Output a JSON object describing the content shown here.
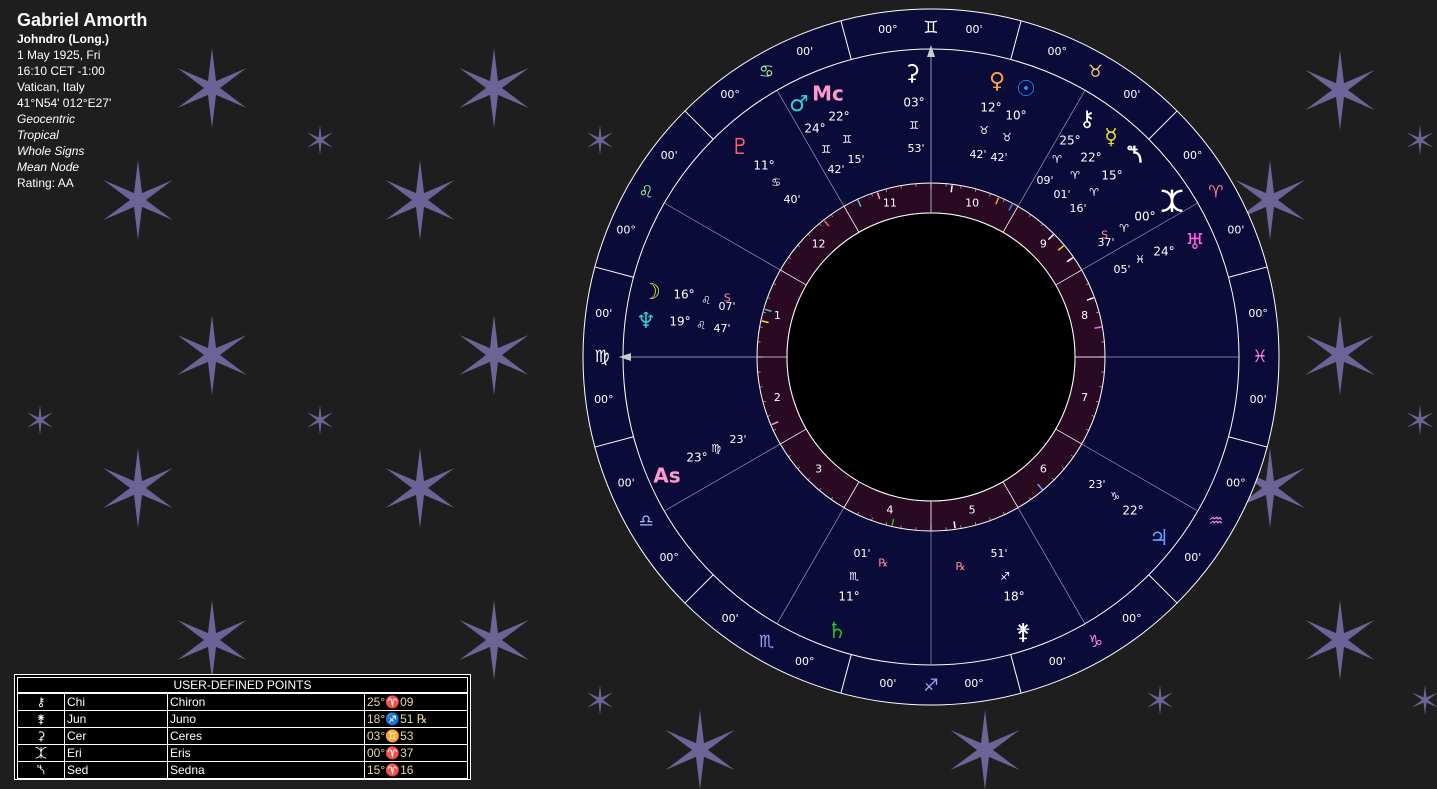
{
  "info": {
    "name": "Gabriel Amorth",
    "house_system": "Johndro (Long.)",
    "date": "1 May 1925, Fri",
    "time": "16:10  CET -1:00",
    "place": "Vatican, Italy",
    "coords": "41°N54' 012°E27'",
    "options": [
      "Geocentric",
      "Tropical",
      "Whole Signs",
      "Mean Node"
    ],
    "rating": "Rating: AA"
  },
  "colors": {
    "background": "#1e1e1e",
    "wheel": "#0b0b3a",
    "house_ring": "#2a0a22",
    "star": "#6c6496"
  },
  "wheel": {
    "zodiac": [
      {
        "glyph": "♊",
        "a": "00°",
        "b": "00'",
        "color": "#ffffff"
      },
      {
        "glyph": "♉",
        "a": "00°",
        "b": "00'",
        "color": "#ffd070"
      },
      {
        "glyph": "♈",
        "a": "00°",
        "b": "00'",
        "color": "#ff8080"
      },
      {
        "glyph": "♓",
        "a": "00°",
        "b": "00'",
        "color": "#ff88dd"
      },
      {
        "glyph": "♒",
        "a": "00°",
        "b": "00'",
        "color": "#ff88dd"
      },
      {
        "glyph": "♑",
        "a": "00°",
        "b": "00'",
        "color": "#ff88dd"
      },
      {
        "glyph": "♐",
        "a": "00°",
        "b": "00'",
        "color": "#a0a0ff"
      },
      {
        "glyph": "♏",
        "a": "00°",
        "b": "00'",
        "color": "#a0a0ff"
      },
      {
        "glyph": "♎",
        "a": "00°",
        "b": "00'",
        "color": "#a0c0ff"
      },
      {
        "glyph": "♍",
        "a": "00°",
        "b": "00'",
        "color": "#ffffff"
      },
      {
        "glyph": "♌",
        "a": "00°",
        "b": "00'",
        "color": "#a0ffa0"
      },
      {
        "glyph": "♋",
        "a": "00°",
        "b": "00'",
        "color": "#a0ffa0"
      }
    ],
    "houses": [
      "10",
      "9",
      "8",
      "7",
      "6",
      "5",
      "4",
      "3",
      "2",
      "1",
      "12",
      "11"
    ],
    "planets": [
      {
        "glyph": "⚳",
        "color": "#ffffff",
        "deg": "03°",
        "sign": "♊",
        "min": "53'",
        "retro": ""
      },
      {
        "glyph": "♀",
        "color": "#ffa040",
        "deg": "12°",
        "sign": "♉",
        "min": "42'",
        "retro": ""
      },
      {
        "glyph": "☉",
        "color": "#2090ff",
        "deg": "10°",
        "sign": "♉",
        "min": "42'",
        "retro": ""
      },
      {
        "glyph": "⚷",
        "color": "#ffffff",
        "deg": "25°",
        "sign": "♈",
        "min": "09'",
        "retro": ""
      },
      {
        "glyph": "☿",
        "color": "#e8e030",
        "deg": "22°",
        "sign": "♈",
        "min": "01'",
        "retro": ""
      },
      {
        "glyph": "⯲",
        "color": "#ffffff",
        "deg": "15°",
        "sign": "♈",
        "min": "16'",
        "retro": "S"
      },
      {
        "glyph": "⯰",
        "color": "#ffffff",
        "deg": "00°",
        "sign": "♈",
        "min": "37'",
        "retro": ""
      },
      {
        "glyph": "♅",
        "color": "#ff60e0",
        "deg": "24°",
        "sign": "♓",
        "min": "05'",
        "retro": ""
      },
      {
        "glyph": "♃",
        "color": "#60a0ff",
        "deg": "22°",
        "sign": "♑",
        "min": "23'",
        "retro": ""
      },
      {
        "glyph": "⚵",
        "color": "#ffffff",
        "deg": "18°",
        "sign": "♐",
        "min": "51'",
        "retro": "℞"
      },
      {
        "glyph": "♄",
        "color": "#20c020",
        "deg": "11°",
        "sign": "♏",
        "min": "01'",
        "retro": "℞"
      },
      {
        "glyph": "As",
        "color": "#ff99cc",
        "deg": "23°",
        "sign": "♍",
        "min": "23'",
        "retro": ""
      },
      {
        "glyph": "☽",
        "color": "#e8e030",
        "deg": "16°",
        "sign": "♌",
        "min": "07'",
        "retro": ""
      },
      {
        "glyph": "♆",
        "color": "#30d0d0",
        "deg": "19°",
        "sign": "♌",
        "min": "47'",
        "retro": "S"
      },
      {
        "glyph": "♇",
        "color": "#ff6060",
        "deg": "11°",
        "sign": "♋",
        "min": "40'",
        "retro": ""
      },
      {
        "glyph": "♂",
        "color": "#30d0d0",
        "deg": "24°",
        "sign": "♊",
        "min": "42'",
        "retro": ""
      },
      {
        "glyph": "Mc",
        "color": "#ff99cc",
        "deg": "22°",
        "sign": "♊",
        "min": "15'",
        "retro": ""
      }
    ]
  },
  "udp": {
    "title": "USER-DEFINED POINTS",
    "rows": [
      {
        "glyph": "⚷",
        "abbr": "Chi",
        "name": "Chiron",
        "pos": "25°♈09"
      },
      {
        "glyph": "⚵",
        "abbr": "Jun",
        "name": "Juno",
        "pos": "18°♐51 ℞"
      },
      {
        "glyph": "⚳",
        "abbr": "Cer",
        "name": "Ceres",
        "pos": "03°♊53"
      },
      {
        "glyph": "⯰",
        "abbr": "Eri",
        "name": "Eris",
        "pos": "00°♈37"
      },
      {
        "glyph": "⯲",
        "abbr": "Sed",
        "name": "Sedna",
        "pos": "15°♈16"
      }
    ]
  }
}
